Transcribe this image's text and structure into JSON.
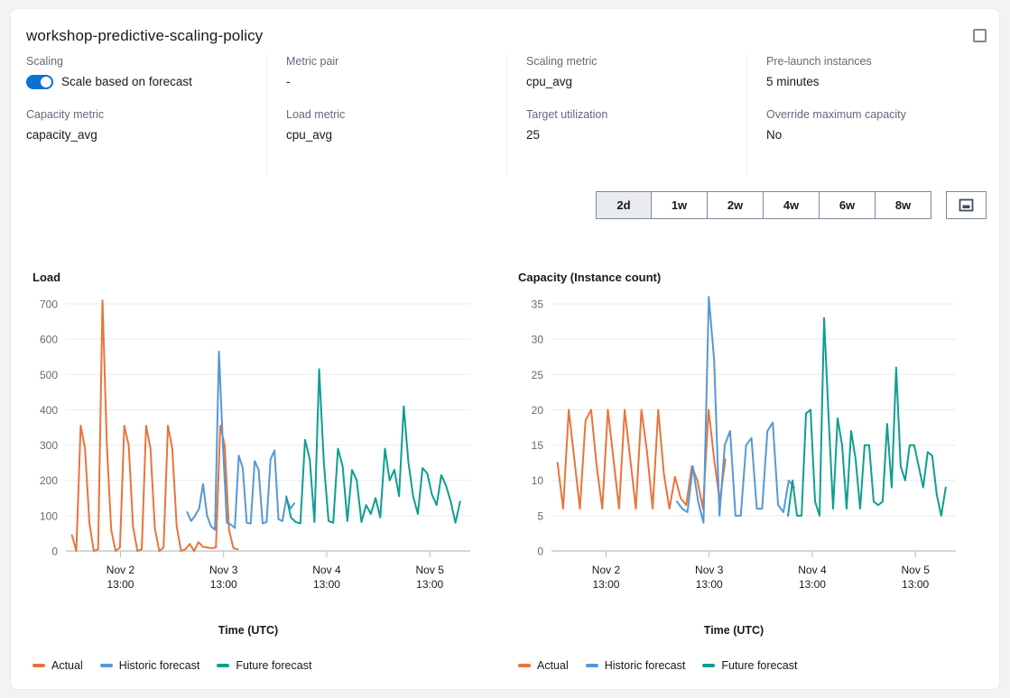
{
  "policy": {
    "title": "workshop-predictive-scaling-policy",
    "select_checkbox": "unchecked"
  },
  "details": [
    [
      {
        "label": "Scaling",
        "value": "Scale based on forecast",
        "type": "toggle",
        "toggle_on": true
      },
      {
        "label": "Capacity metric",
        "value": "capacity_avg",
        "type": "text"
      }
    ],
    [
      {
        "label": "Metric pair",
        "value": "-",
        "type": "text"
      },
      {
        "label": "Load metric",
        "value": "cpu_avg",
        "type": "text"
      }
    ],
    [
      {
        "label": "Scaling metric",
        "value": "cpu_avg",
        "type": "text"
      },
      {
        "label": "Target utilization",
        "value": "25",
        "type": "text"
      }
    ],
    [
      {
        "label": "Pre-launch instances",
        "value": "5 minutes",
        "type": "text"
      },
      {
        "label": "Override maximum capacity",
        "value": "No",
        "type": "text"
      }
    ]
  ],
  "range_selector": {
    "options": [
      "2d",
      "1w",
      "2w",
      "4w",
      "6w",
      "8w"
    ],
    "selected": "2d",
    "expand_button_icon": "image-view-icon"
  },
  "colors": {
    "actual": "#e8743b",
    "historic_forecast": "#5598d8",
    "future_forecast": "#0f9e91",
    "grid": "#e9ebed",
    "accent": "#0972d3",
    "text": "#16191f",
    "muted": "#5f6b7a"
  },
  "legend": [
    {
      "label": "Actual",
      "color": "#e8743b"
    },
    {
      "label": "Historic forecast",
      "color": "#5598d8"
    },
    {
      "label": "Future forecast",
      "color": "#0f9e91"
    }
  ],
  "chart_data": [
    {
      "type": "line",
      "title": "Load",
      "xlabel": "Time (UTC)",
      "ylabel": "Load",
      "ylim": [
        0,
        700
      ],
      "yticks": [
        0,
        100,
        200,
        300,
        400,
        500,
        600,
        700
      ],
      "xticks": [
        "Nov 2\n13:00",
        "Nov 3\n13:00",
        "Nov 4\n13:00",
        "Nov 5\n13:00"
      ],
      "xtick_labels": [
        {
          "day": "Nov 2",
          "time": "13:00"
        },
        {
          "day": "Nov 3",
          "time": "13:00"
        },
        {
          "day": "Nov 4",
          "time": "13:00"
        },
        {
          "day": "Nov 5",
          "time": "13:00"
        }
      ],
      "xtick_positions": [
        0.135,
        0.39,
        0.645,
        0.9
      ],
      "grid": true,
      "legend_position": "bottom-left",
      "series": [
        {
          "name": "Actual",
          "color": "#e8743b",
          "x_start": 0.015,
          "x_end": 0.425,
          "values": [
            45,
            0,
            355,
            290,
            80,
            0,
            5,
            710,
            300,
            60,
            0,
            10,
            355,
            300,
            70,
            0,
            5,
            355,
            290,
            65,
            0,
            10,
            355,
            290,
            70,
            0,
            5,
            20,
            0,
            25,
            12,
            10,
            8,
            10,
            355,
            300,
            60,
            8,
            5
          ]
        },
        {
          "name": "Historic forecast",
          "color": "#5598d8",
          "x_start": 0.3,
          "x_end": 0.565,
          "values": [
            110,
            85,
            100,
            120,
            190,
            100,
            70,
            60,
            565,
            300,
            80,
            75,
            65,
            270,
            235,
            80,
            78,
            255,
            230,
            78,
            82,
            260,
            285,
            90,
            85,
            150,
            120,
            135
          ]
        },
        {
          "name": "Future forecast",
          "color": "#0f9e91",
          "x_start": 0.545,
          "x_end": 0.975,
          "values": [
            155,
            95,
            82,
            78,
            315,
            260,
            82,
            515,
            250,
            85,
            80,
            290,
            240,
            85,
            230,
            200,
            82,
            130,
            105,
            150,
            95,
            290,
            200,
            230,
            155,
            410,
            250,
            155,
            105,
            235,
            220,
            160,
            130,
            215,
            185,
            140,
            80,
            140
          ]
        }
      ]
    },
    {
      "type": "line",
      "title": "Capacity (Instance count)",
      "xlabel": "Time (UTC)",
      "ylabel": "Capacity (Instance count)",
      "ylim": [
        0,
        35
      ],
      "yticks": [
        0,
        5,
        10,
        15,
        20,
        25,
        30,
        35
      ],
      "xticks": [
        "Nov 2\n13:00",
        "Nov 3\n13:00",
        "Nov 4\n13:00",
        "Nov 5\n13:00"
      ],
      "xtick_labels": [
        {
          "day": "Nov 2",
          "time": "13:00"
        },
        {
          "day": "Nov 3",
          "time": "13:00"
        },
        {
          "day": "Nov 4",
          "time": "13:00"
        },
        {
          "day": "Nov 5",
          "time": "13:00"
        }
      ],
      "xtick_positions": [
        0.135,
        0.39,
        0.645,
        0.9
      ],
      "grid": true,
      "legend_position": "bottom-left",
      "series": [
        {
          "name": "Actual",
          "color": "#e8743b",
          "x_start": 0.015,
          "x_end": 0.43,
          "values": [
            12.5,
            6,
            20,
            13,
            6,
            18.5,
            20,
            12,
            6,
            20,
            13,
            6,
            20,
            13,
            6,
            20,
            14,
            6,
            20,
            11,
            6,
            10.5,
            7.5,
            6.5,
            12,
            10,
            6,
            20,
            13,
            7,
            13
          ]
        },
        {
          "name": "Historic forecast",
          "color": "#5598d8",
          "x_start": 0.31,
          "x_end": 0.6,
          "values": [
            7,
            6,
            5.5,
            12,
            7,
            4,
            36,
            27,
            5,
            15,
            17,
            5,
            5,
            15,
            16,
            6,
            6,
            17,
            18.2,
            6.5,
            5.5,
            10,
            9
          ]
        },
        {
          "name": "Future forecast",
          "color": "#0f9e91",
          "x_start": 0.585,
          "x_end": 0.975,
          "values": [
            5,
            10,
            5,
            5,
            19.5,
            20,
            7,
            5,
            33,
            19,
            6,
            18.8,
            15,
            6,
            17,
            13,
            6,
            15,
            15,
            7,
            6.5,
            7,
            18,
            9,
            26,
            12,
            10,
            15,
            15,
            12,
            9,
            14,
            13.5,
            8,
            5,
            9
          ]
        }
      ]
    }
  ]
}
